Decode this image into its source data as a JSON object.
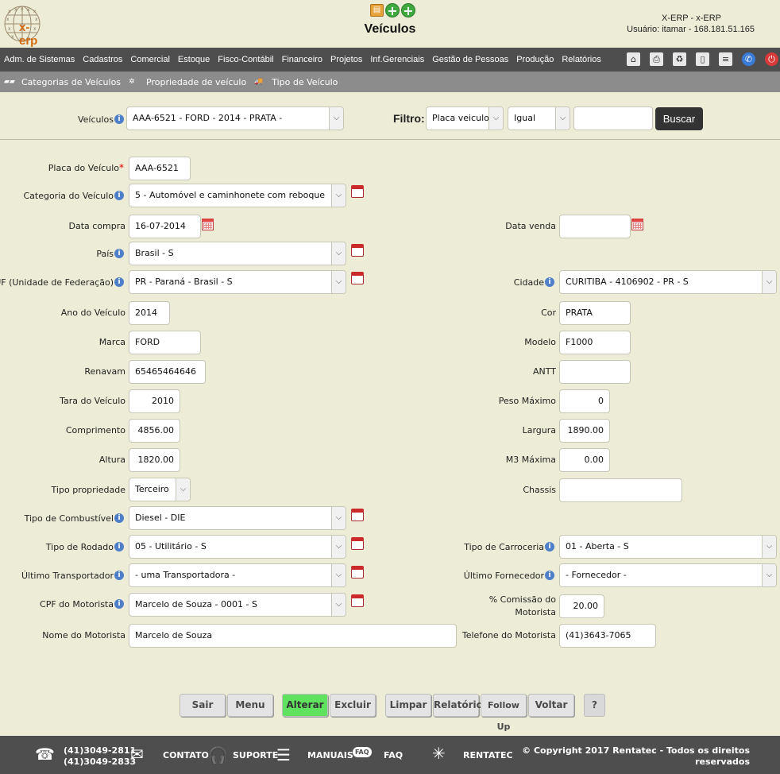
{
  "header": {
    "logo_text": "x-erp",
    "page_title": "Veículos",
    "system_name": "X-ERP - x-ERP",
    "user_info": "Usuário: itamar - 168.181.51.165"
  },
  "menu": [
    "Adm. de Sistemas",
    "Cadastros",
    "Comercial",
    "Estoque",
    "Fisco-Contábil",
    "Financeiro",
    "Projetos",
    "Inf.Gerenciais",
    "Gestão de Pessoas",
    "Produção",
    "Relatórios"
  ],
  "submenu": [
    "Categorias de Veículos",
    "Propriedade de veículo",
    "Tipo de Veículo"
  ],
  "search": {
    "vehicle_label": "Veículos",
    "vehicle_value": "AAA-6521 - FORD - 2014 - PRATA -",
    "filter_label": "Filtro:",
    "filter_field": "Placa veiculo",
    "filter_op": "Igual",
    "filter_value": "",
    "search_button": "Buscar"
  },
  "form": {
    "placa_label": "Placa do Veículo",
    "placa": "AAA-6521",
    "categoria_label": "Categoria do Veículo",
    "categoria": "5 - Automóvel e caminhonete com reboque",
    "data_compra_label": "Data compra",
    "data_compra": "16-07-2014",
    "data_venda_label": "Data venda",
    "data_venda": "",
    "pais_label": "País",
    "pais": "Brasil - S",
    "uf_label": "UF (Unidade de Federação)",
    "uf": "PR - Paraná - Brasil - S",
    "cidade_label": "Cidade",
    "cidade": "CURITIBA - 4106902 - PR - S",
    "ano_label": "Ano do Veículo",
    "ano": "2014",
    "cor_label": "Cor",
    "cor": "PRATA",
    "marca_label": "Marca",
    "marca": "FORD",
    "modelo_label": "Modelo",
    "modelo": "F1000",
    "renavam_label": "Renavam",
    "renavam": "65465464646",
    "antt_label": "ANTT",
    "antt": "",
    "tara_label": "Tara do Veículo",
    "tara": "2010",
    "peso_label": "Peso Máximo",
    "peso": "0",
    "comprimento_label": "Comprimento",
    "comprimento": "4856.00",
    "largura_label": "Largura",
    "largura": "1890.00",
    "altura_label": "Altura",
    "altura": "1820.00",
    "m3_label": "M3 Máxima",
    "m3": "0.00",
    "tipo_prop_label": "Tipo propriedade",
    "tipo_prop": "Terceiro",
    "chassis_label": "Chassis",
    "chassis": "",
    "combustivel_label": "Tipo de Combustível",
    "combustivel": "Diesel - DIE",
    "rodado_label": "Tipo de Rodado",
    "rodado": "05 - Utilitário - S",
    "carroceria_label": "Tipo de Carroceria",
    "carroceria": "01 - Aberta - S",
    "transportador_label": "Último Transportador",
    "transportador": "- uma Transportadora -",
    "fornecedor_label": "Último Fornecedor",
    "fornecedor": "- Fornecedor -",
    "cpf_label": "CPF do Motorista",
    "cpf": "Marcelo de Souza - 0001 - S",
    "comissao_label_1": "% Comissão do",
    "comissao_label_2": "Motorista",
    "comissao": "20.00",
    "nome_label": "Nome do Motorista",
    "nome": "Marcelo de Souza",
    "telefone_label": "Telefone do Motorista",
    "telefone": "(41)3643-7065"
  },
  "buttons": {
    "sair": "Sair",
    "menu": "Menu",
    "alterar": "Alterar",
    "excluir": "Excluir",
    "limpar": "Limpar",
    "relatorio": "Relatório",
    "followup": "Follow Up",
    "voltar": "Voltar",
    "help": "?"
  },
  "footer": {
    "phone1": "(41)3049-2811",
    "phone2": "(41)3049-2833",
    "contato": "CONTATO",
    "suporte": "SUPORTE",
    "manuais": "MANUAIS",
    "faq": "FAQ",
    "faq_badge": "FAQ",
    "rentatec": "RENTATEC",
    "copyright_1": "© Copyright 2017 Rentatec - Todos os direitos",
    "copyright_2": "reservados"
  }
}
